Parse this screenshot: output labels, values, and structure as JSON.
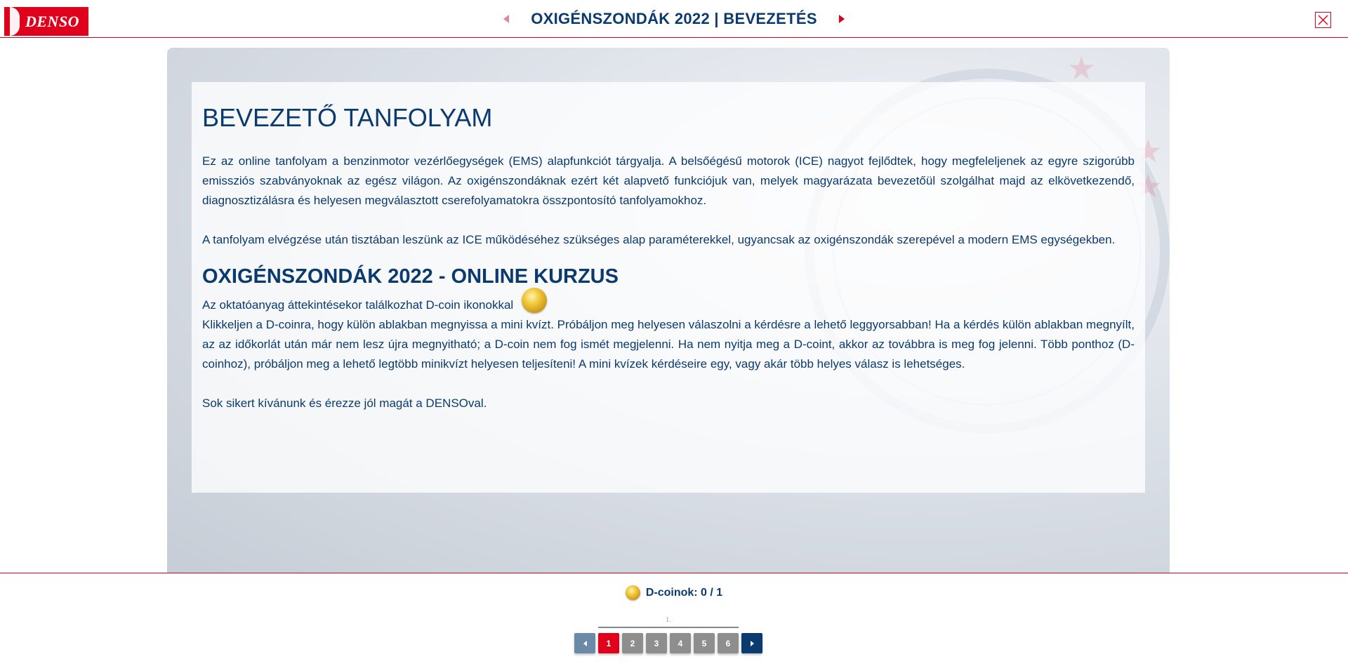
{
  "header": {
    "logo_text": "DENSO",
    "title": "OXIGÉNSZONDÁK 2022 | BEVEZETÉS",
    "prev_icon": "caret-left-icon",
    "next_icon": "caret-right-icon",
    "close_icon": "close-icon"
  },
  "content": {
    "heading": "BEVEZETŐ TANFOLYAM",
    "paragraph1": "Ez az online tanfolyam a benzinmotor vezérlőegységek (EMS) alapfunkciót tárgyalja. A belsőégésű motorok (ICE) nagyot fejlődtek, hogy megfeleljenek az egyre szigorúbb emissziós szabványoknak az egész világon. Az oxigénszondáknak ezért két alapvető funkciójuk van, melyek magyarázata bevezetőül szolgálhat majd az elkövetkezendő, diagnosztizálásra és helyesen megválasztott cserefolyamatokra összpontosító tanfolyamokhoz.",
    "paragraph2": "A tanfolyam elvégzése után tisztában leszünk az ICE működéséhez szükséges alap paraméterekkel, ugyancsak az oxigénszondák szerepével a modern EMS egységekben.",
    "subheading": "OXIGÉNSZONDÁK 2022 - ONLINE KURZUS",
    "coin_intro": "Az oktatóanyag áttekintésekor találkozhat D-coin ikonokkal",
    "paragraph3": "Klikkeljen a D-coinra, hogy külön ablakban megnyissa a mini kvízt. Próbáljon meg helyesen válaszolni a kérdésre a lehető leggyorsabban! Ha a kérdés külön ablakban megnyílt, az az időkorlát után már nem lesz újra megnyitható; a D-coin nem fog ismét megjelenni. Ha nem nyitja meg a D-coint, akkor az továbbra is meg fog jelenni. Több ponthoz (D-coinhoz), próbáljon meg a lehető legtöbb minikvízt helyesen teljesíteni! A mini kvízek kérdéseire egy, vagy akár több helyes válasz is lehetséges.",
    "paragraph4": "Sok sikert kívánunk és érezze jól magát a DENSOval."
  },
  "footer": {
    "coins_status": "D-coinok: 0 / 1",
    "section_label": "1.",
    "pages": [
      "1",
      "2",
      "3",
      "4",
      "5",
      "6"
    ],
    "active_page": "1"
  },
  "colors": {
    "brand_red": "#e0001b",
    "brand_blue": "#0b3a6e",
    "inactive_page": "#8e8e8e"
  }
}
